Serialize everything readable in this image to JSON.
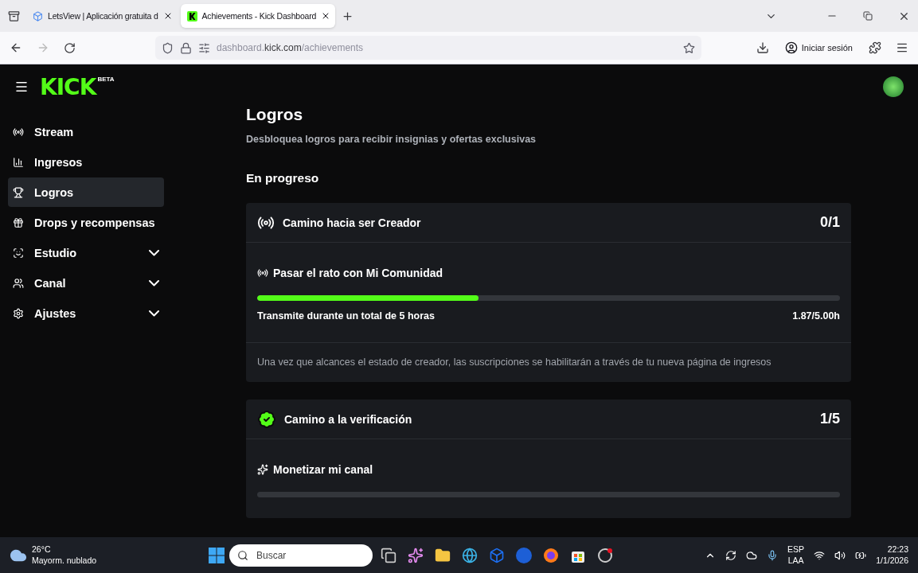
{
  "browser": {
    "tabs": [
      {
        "title": "LetsView | Aplicación gratuita d",
        "selected": false
      },
      {
        "title": "Achievements - Kick Dashboard",
        "selected": true
      }
    ],
    "url": {
      "host": "dashboard.",
      "domain": "kick.com",
      "path": "/achievements"
    },
    "sign_in": "Iniciar sesión"
  },
  "logo": {
    "text": "KICK",
    "badge": "BETA"
  },
  "sidebar": {
    "items": [
      {
        "label": "Stream",
        "selected": false,
        "expandable": false
      },
      {
        "label": "Ingresos",
        "selected": false,
        "expandable": false
      },
      {
        "label": "Logros",
        "selected": true,
        "expandable": false
      },
      {
        "label": "Drops y recompensas",
        "selected": false,
        "expandable": false
      },
      {
        "label": "Estudio",
        "selected": false,
        "expandable": true
      },
      {
        "label": "Canal",
        "selected": false,
        "expandable": true
      },
      {
        "label": "Ajustes",
        "selected": false,
        "expandable": true
      }
    ]
  },
  "page": {
    "title": "Logros",
    "subtitle": "Desbloquea logros para recibir insignias y ofertas exclusivas",
    "section": "En progreso"
  },
  "achievements": [
    {
      "kind": "broadcast",
      "title": "Camino hacia ser Creador",
      "progress": "0/1",
      "tasks": [
        {
          "kind": "broadcast",
          "title": "Pasar el rato con Mi Comunidad",
          "level": 0.38,
          "description": "Transmite durante un total de 5 horas",
          "reading": "1.87/5.00h"
        }
      ],
      "note": "Una vez que alcances el estado de creador, las suscripciones se habilitarán a través de tu nueva página de ingresos"
    },
    {
      "kind": "verified",
      "title": "Camino a la verificación",
      "progress": "1/5",
      "tasks": [
        {
          "kind": "sparkle",
          "title": "Monetizar mi canal",
          "level": 0
        }
      ]
    }
  ],
  "taskbar": {
    "temperature": "26°C",
    "weather": "Mayorm. nublado",
    "search_placeholder": "Buscar",
    "language": "ESP",
    "layout": "LAA",
    "time": "22:23",
    "date": "1/1/2026"
  }
}
